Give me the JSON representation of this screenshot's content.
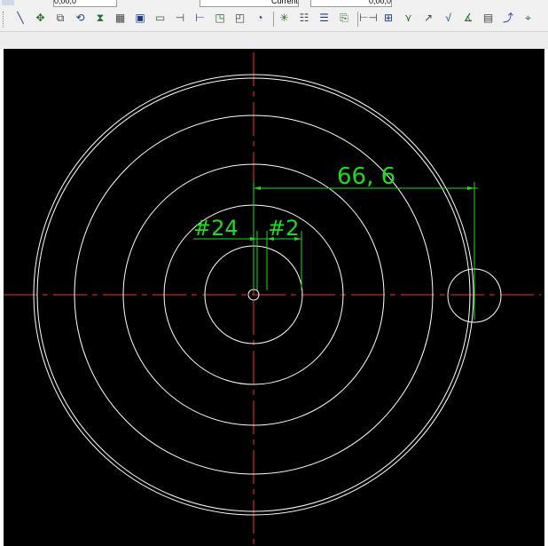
{
  "toolbar_top": {
    "fields": [
      "0,00,0",
      "Current",
      "0,00,0"
    ]
  },
  "toolbar": {
    "icons": [
      {
        "name": "line-tool-icon",
        "glyph": "╲"
      },
      {
        "name": "move-icon",
        "glyph": "✥"
      },
      {
        "name": "copy-icon",
        "glyph": "⧉"
      },
      {
        "name": "rotate-icon",
        "glyph": "⟲"
      },
      {
        "name": "mirror-icon",
        "glyph": "⧗"
      },
      {
        "name": "array-icon",
        "glyph": "▦"
      },
      {
        "name": "offset-icon",
        "glyph": "▣"
      },
      {
        "name": "rectangle-icon",
        "glyph": "▭"
      },
      {
        "name": "trim-icon",
        "glyph": "⊣"
      },
      {
        "name": "extend-icon",
        "glyph": "⊢"
      },
      {
        "name": "scale-icon",
        "glyph": "◳"
      },
      {
        "name": "stretch-icon",
        "glyph": "◰"
      },
      {
        "name": "fillet-icon",
        "glyph": "◔"
      },
      {
        "name": "explode-icon",
        "glyph": "✳"
      },
      {
        "name": "properties-icon",
        "glyph": "☷"
      },
      {
        "name": "layer-icon",
        "glyph": "☰"
      },
      {
        "name": "match-icon",
        "glyph": "⎘"
      },
      {
        "name": "linear-dimension-icon",
        "glyph": "⊢⊣"
      },
      {
        "name": "ordinate-dimension-icon",
        "glyph": "⊞"
      },
      {
        "name": "arc-length-icon",
        "glyph": "⋎"
      },
      {
        "name": "radius-icon",
        "glyph": "↗"
      },
      {
        "name": "diameter-icon",
        "glyph": "√"
      },
      {
        "name": "angular-icon",
        "glyph": "∡"
      },
      {
        "name": "tolerance-icon",
        "glyph": "▤"
      },
      {
        "name": "leader-icon",
        "glyph": "⤴"
      },
      {
        "name": "dimension-style-icon",
        "glyph": "⌖"
      }
    ]
  },
  "drawing": {
    "dimension_overall": "66, 6",
    "dimension_left": "#24",
    "dimension_right": "#2",
    "colors": {
      "background": "#000000",
      "geometry": "#ffffff",
      "centerline": "#ff2a2a",
      "dimension": "#1fdc1f"
    }
  }
}
